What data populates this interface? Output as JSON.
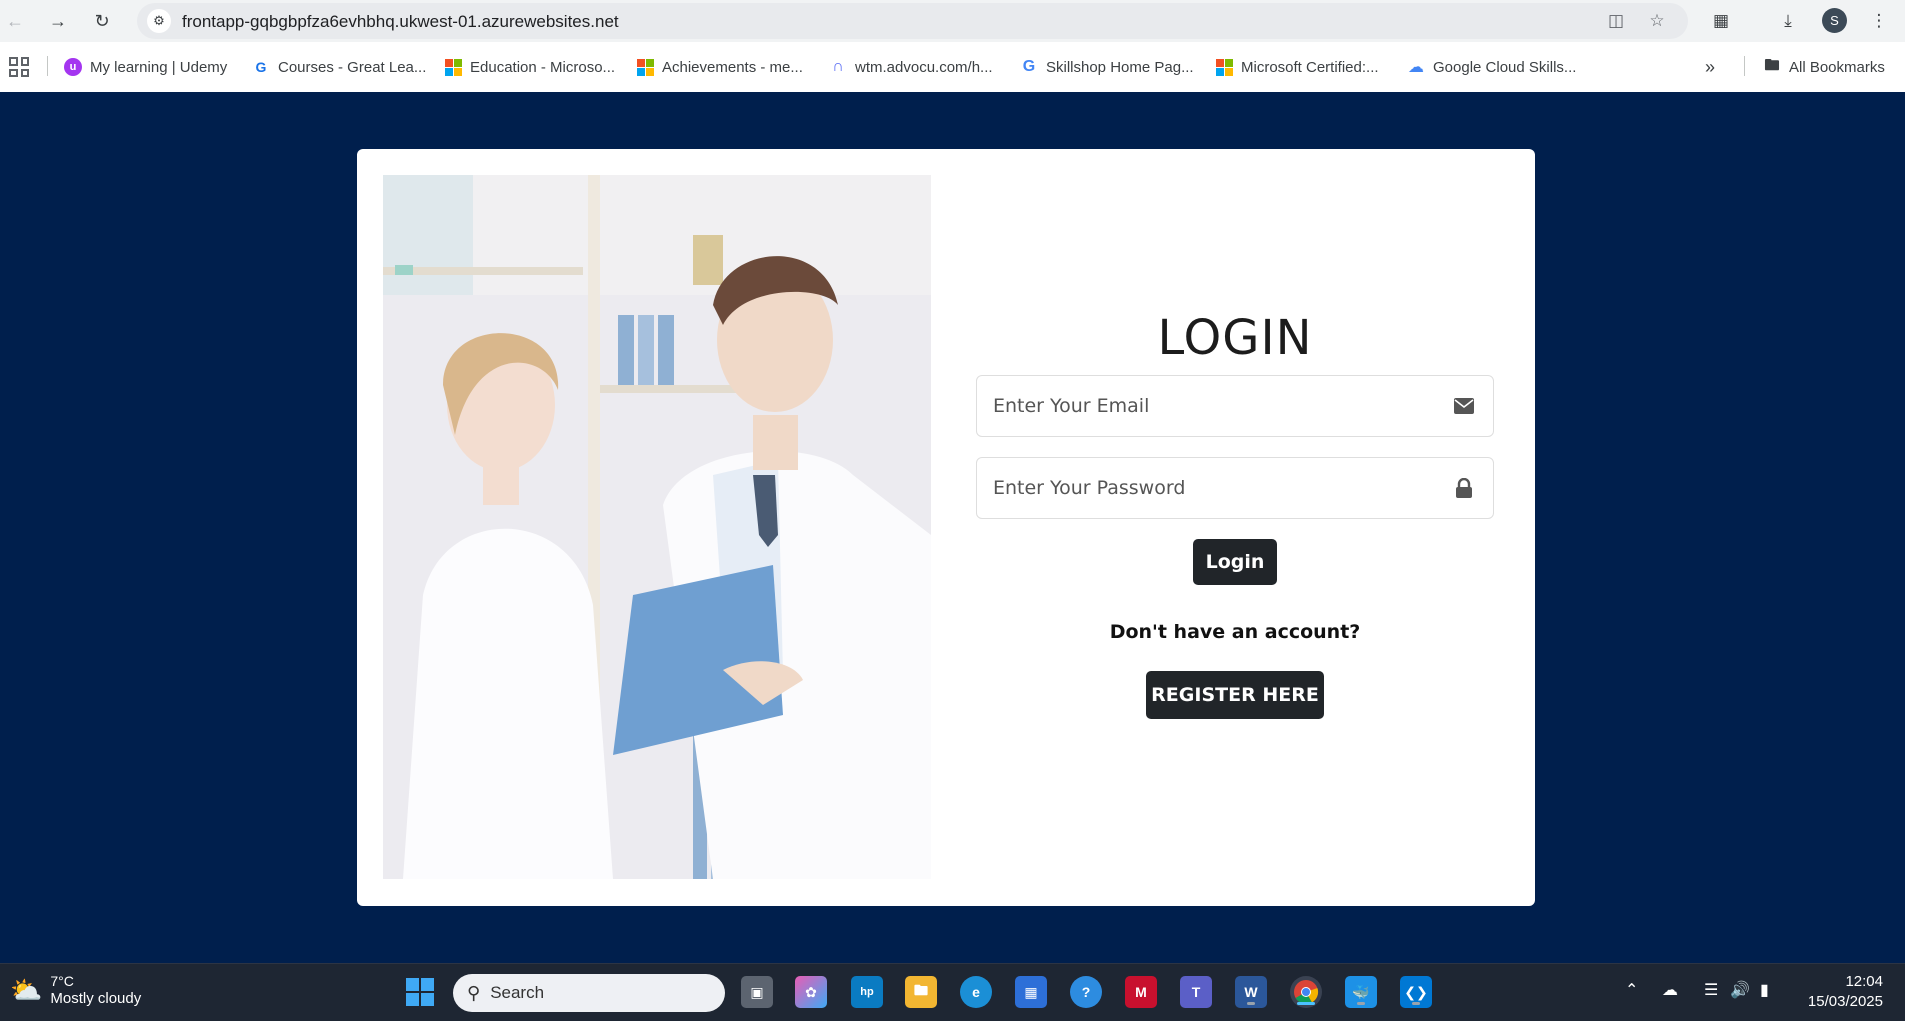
{
  "browser": {
    "url": "frontapp-gqbgbpfza6evhbhq.ukwest-01.azurewebsites.net",
    "profile_initial": "S",
    "bookmarks": [
      {
        "label": "My learning | Udemy",
        "icon": "udemy-icon",
        "color": "#a435f0"
      },
      {
        "label": "Courses - Great Lea...",
        "icon": "great-learning-icon",
        "color": "#1a73e8"
      },
      {
        "label": "Education - Microso...",
        "icon": "microsoft-icon"
      },
      {
        "label": "Achievements - me...",
        "icon": "microsoft-icon"
      },
      {
        "label": "wtm.advocu.com/h...",
        "icon": "magnet-icon",
        "color": "#5b6ef5"
      },
      {
        "label": "Skillshop Home Pag...",
        "icon": "google-icon"
      },
      {
        "label": "Microsoft Certified:...",
        "icon": "microsoft-icon"
      },
      {
        "label": "Google Cloud Skills...",
        "icon": "google-cloud-icon"
      }
    ],
    "all_bookmarks_label": "All Bookmarks"
  },
  "page": {
    "background_color": "#001f4d",
    "login": {
      "title": "LOGIN",
      "email_placeholder": "Enter Your Email",
      "password_placeholder": "Enter Your Password",
      "login_button": "Login",
      "no_account_text": "Don't have an account?",
      "register_button": "REGISTER HERE"
    }
  },
  "taskbar": {
    "weather_temp": "7°C",
    "weather_desc": "Mostly cloudy",
    "search_label": "Search",
    "time": "12:04",
    "date": "15/03/2025"
  }
}
